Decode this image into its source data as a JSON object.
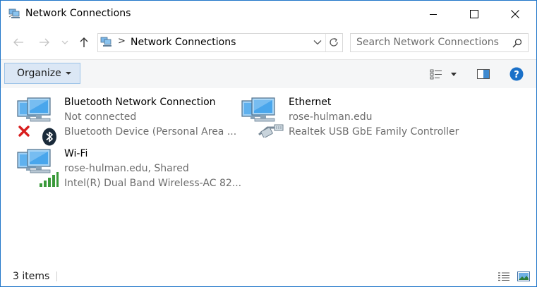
{
  "window": {
    "title": "Network Connections",
    "controls": {
      "minimize": "minimize",
      "maximize": "maximize",
      "close": "close"
    }
  },
  "address": {
    "path": "Network Connections",
    "separator": ">"
  },
  "search": {
    "placeholder": "Search Network Connections",
    "value": ""
  },
  "toolbar": {
    "organize_label": "Organize"
  },
  "connections": [
    {
      "name": "Bluetooth Network Connection",
      "status": "Not connected",
      "device": "Bluetooth Device (Personal Area ...",
      "icon": "bluetooth-network-icon",
      "overlay": [
        "disconnected-x-icon",
        "bluetooth-icon"
      ]
    },
    {
      "name": "Ethernet",
      "status": "rose-hulman.edu",
      "device": "Realtek USB GbE Family Controller",
      "icon": "ethernet-network-icon",
      "overlay": [
        "ethernet-cable-icon"
      ]
    },
    {
      "name": "Wi-Fi",
      "status": "rose-hulman.edu, Shared",
      "device": "Intel(R) Dual Band Wireless-AC 82...",
      "icon": "wifi-network-icon",
      "overlay": [
        "wifi-signal-bars-icon"
      ]
    }
  ],
  "statusbar": {
    "item_count": "3 items"
  },
  "colors": {
    "accent": "#1f75c9",
    "organize_bg": "#dbe7f5",
    "help_blue": "#1a70c8",
    "disconnected_red": "#d81e1e",
    "signal_green": "#3a9a3a"
  }
}
